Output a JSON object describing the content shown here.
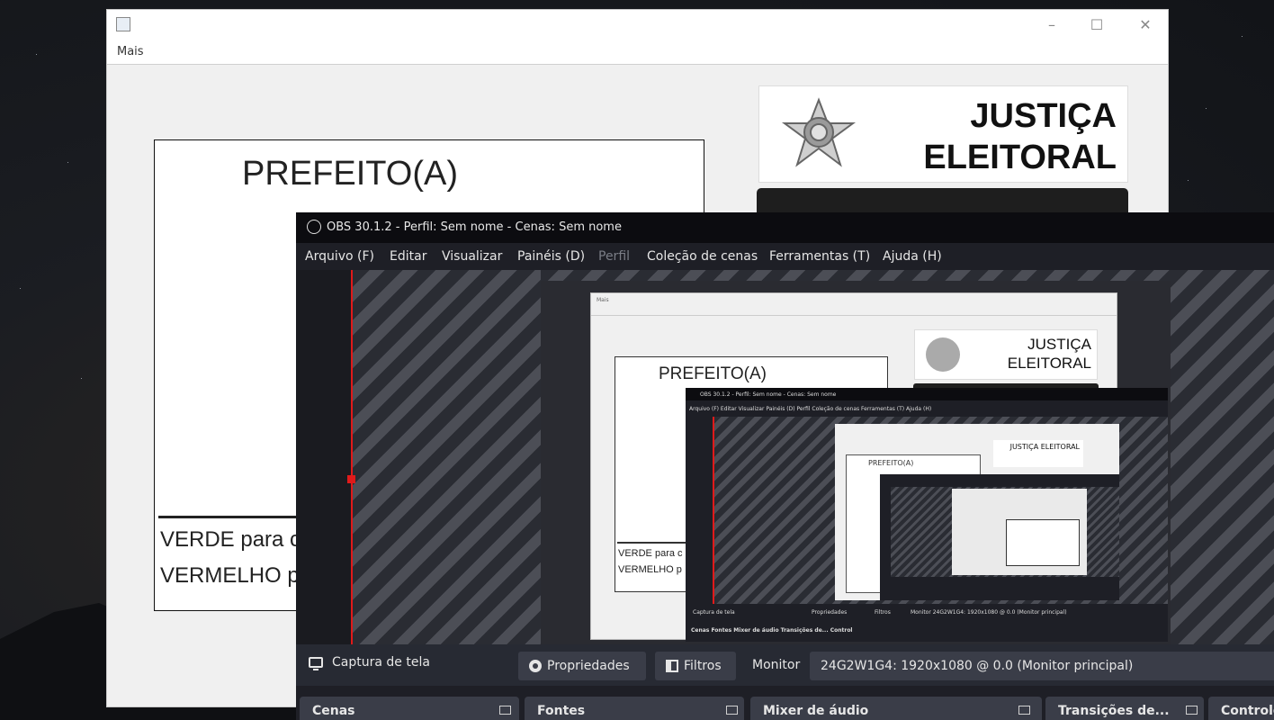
{
  "java_window": {
    "menu": "Mais",
    "ballot_title": "PREFEITO(A)",
    "instructions": [
      "VERDE para c",
      "VERMELHO p"
    ],
    "header_title_line1": "JUSTIÇA",
    "header_title_line2": "ELEITORAL",
    "window_controls": {
      "minimize": "–",
      "maximize": "☐",
      "close": "✕"
    }
  },
  "obs": {
    "title": "OBS 30.1.2 - Perfil: Sem nome - Cenas: Sem nome",
    "menu": [
      {
        "label": "Arquivo (F)",
        "disabled": false
      },
      {
        "label": "Editar",
        "disabled": false
      },
      {
        "label": "Visualizar",
        "disabled": false
      },
      {
        "label": "Painéis (D)",
        "disabled": false
      },
      {
        "label": "Perfil",
        "disabled": true
      },
      {
        "label": "Coleção de cenas",
        "disabled": false
      },
      {
        "label": "Ferramentas (T)",
        "disabled": false
      },
      {
        "label": "Ajuda (H)",
        "disabled": false
      }
    ],
    "source_bar": {
      "source_name": "Captura de tela",
      "properties_label": "Propriedades",
      "filters_label": "Filtros",
      "monitor_label": "Monitor",
      "monitor_value": "24G2W1G4: 1920x1080 @ 0.0 (Monitor principal)"
    },
    "docks": [
      "Cenas",
      "Fontes",
      "Mixer de áudio",
      "Transições de...",
      "Controles"
    ]
  },
  "nested_capture": {
    "menu": "Mais",
    "ballot_title": "PREFEITO(A)",
    "instructions": [
      "VERDE para c",
      "VERMELHO p"
    ],
    "header_title_line1": "JUSTIÇA",
    "header_title_line2": "ELEITORAL",
    "obs_title": "OBS 30.1.2 - Perfil: Sem nome - Cenas: Sem nome",
    "obs_menu": "Arquivo (F)   Editar   Visualizar   Painéis (D)   Perfil   Coleção de cenas   Ferramentas (T)   Ajuda (H)",
    "source_name": "Captura de tela",
    "properties_label": "Propriedades",
    "filters_label": "Filtros",
    "monitor_text": "Monitor   24G2W1G4: 1920x1080 @ 0.0 (Monitor principal)",
    "docks_text": "Cenas                    Fontes                    Mixer de áudio                    Transições de...   Control",
    "inner_ballot_title": "PREFEITO(A)",
    "inner_header": "JUSTIÇA ELEITORAL"
  },
  "colors": {
    "obs_bg": "#1e1f26",
    "obs_button": "#3a3d48",
    "selection_red": "#e01a1a"
  }
}
